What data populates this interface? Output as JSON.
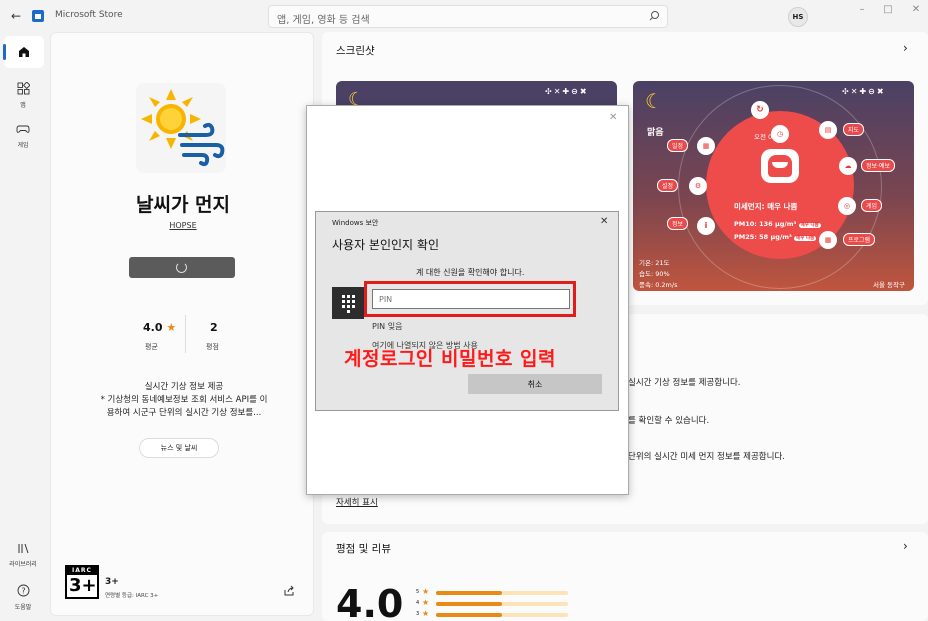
{
  "titlebar": {
    "app_name": "Microsoft Store",
    "search_placeholder": "앱, 게임, 영화 등 검색",
    "avatar_initials": "HS",
    "window_controls": [
      "–",
      "□",
      "✕"
    ]
  },
  "nav": {
    "items": [
      {
        "label": "",
        "icon": "home-icon"
      },
      {
        "label": "앱",
        "icon": "apps-icon"
      },
      {
        "label": "게임",
        "icon": "gamepad-icon"
      },
      {
        "label": "라이브러리",
        "icon": "library-icon"
      },
      {
        "label": "도움말",
        "icon": "help-icon"
      }
    ]
  },
  "app": {
    "title": "날씨가 먼지",
    "publisher": "HOPSE",
    "rating": "4.0",
    "rating_label": "평균",
    "reviews_count": "2",
    "reviews_label": "평점",
    "description_line1": "실시간 기상 정보 제공",
    "description_line2": "* 기상청의 동네예보정보 조회 서비스 API를 이",
    "description_line3": "용하여 시군구 단위의 실시간 기상 정보를...",
    "tag": "뉴스 및 날씨",
    "age_rating_badge": "3+",
    "age_rating_title": "3+",
    "age_rating_sub": "연령별 등급: IARC 3+",
    "iarc_text": "IARC"
  },
  "screenshots": {
    "section_title": "스크린샷",
    "controls": "✣✕✚⊖✖",
    "ss2": {
      "weather": "맑음",
      "time": "오전 01:09",
      "status": "미세먼지: 매우 나쁨",
      "pm10": "PM10: 136 μg/m³",
      "pm10_badge": "매우 나쁨",
      "pm25": "PM25: 58 μg/m³",
      "pm25_badge": "매우 나쁨",
      "temp": "기온: 21도",
      "humidity": "습도: 90%",
      "wind": "풍속: 0.2m/s",
      "location": "서울 동작구",
      "labels": {
        "schedule": "일정",
        "settings": "설정",
        "info": "정보",
        "map": "지도",
        "forecast": "정보·예보",
        "game": "게임",
        "program": "프로그램"
      }
    }
  },
  "description_section": {
    "line1": "실시간 기상 정보를 제공합니다.",
    "line2": "를 확인할 수 있습니다.",
    "line3": "단위의 실시간 미세 먼지 정보를 제공합니다.",
    "more_link": "자세히 표시"
  },
  "reviews": {
    "section_title": "평점 및 리뷰",
    "big_rating": "4.0",
    "bars": [
      {
        "star": "5",
        "fraction": 0.5
      },
      {
        "star": "4",
        "fraction": 0.5
      },
      {
        "star": "3",
        "fraction": 0.5
      }
    ]
  },
  "dialog": {
    "title": "Windows 보안",
    "heading": "사용자 본인인지 확인",
    "subtitle": "계 대한 신원을 확인해야 합니다.",
    "pin_placeholder": "PIN",
    "pin_forgot": "PIN 잊음",
    "alt_text": "여기에 나열되지 않은 방법 사용",
    "cancel_label": "취소",
    "overlay_annotation": "계정로그인 비밀번호 입력"
  },
  "colors": {
    "accent": "#1e6ac9",
    "highlight": "#e21b1b",
    "star": "#e88a16"
  }
}
